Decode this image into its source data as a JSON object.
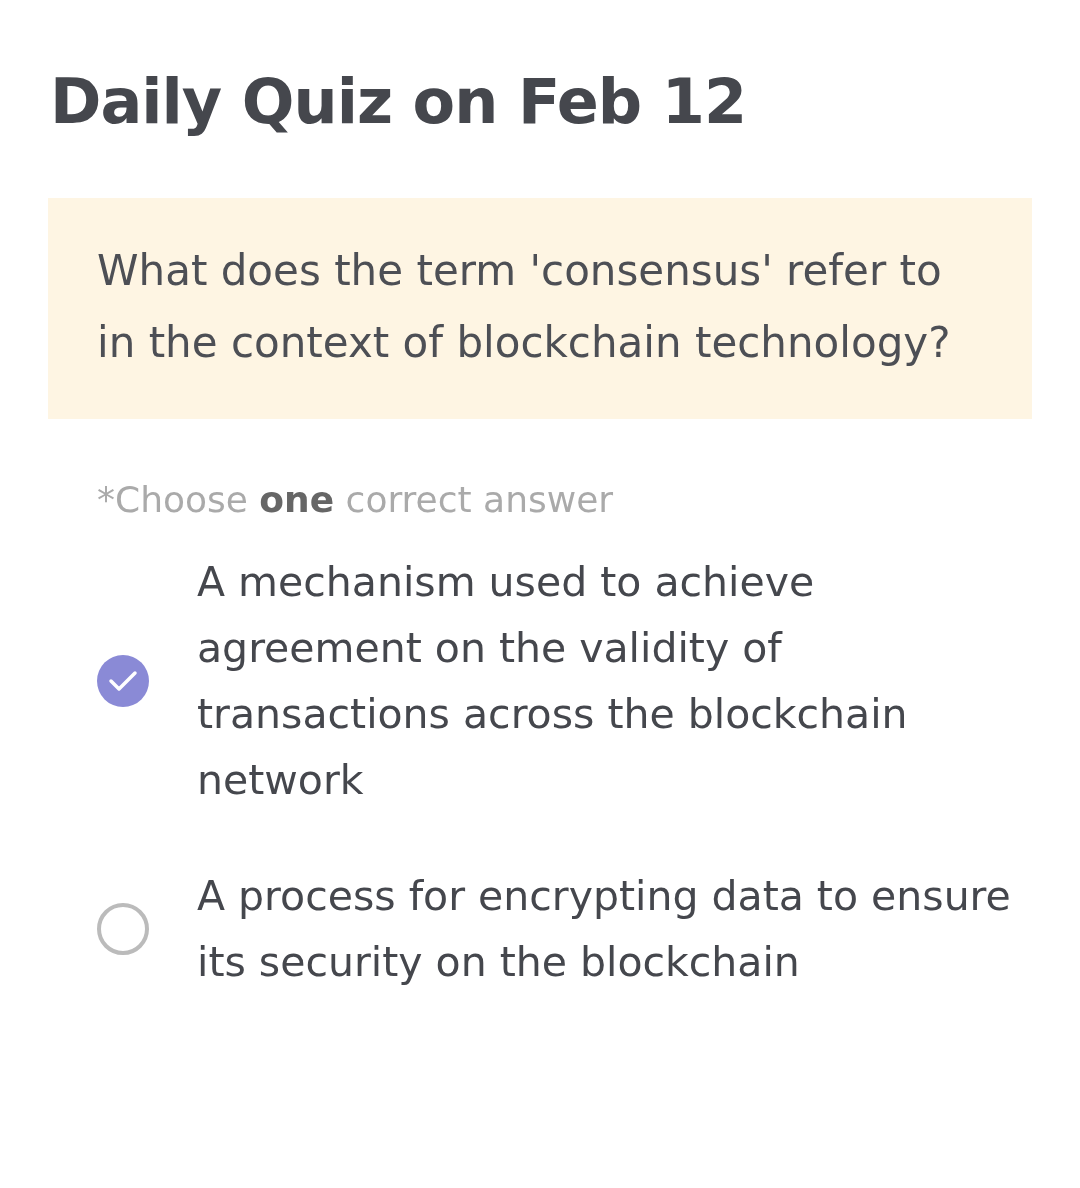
{
  "title": "Daily Quiz on Feb 12",
  "question": "What does the term 'consensus' refer to in the context of blockchain technology?",
  "hint": "*Choose **one** correct answer",
  "options": [
    {
      "label": "A mechanism used to achieve agreement on the validity of transactions across the blockchain network",
      "selected": true
    },
    {
      "label": "A process for encrypting data to ensure its security on the blockchain",
      "selected": false
    }
  ]
}
